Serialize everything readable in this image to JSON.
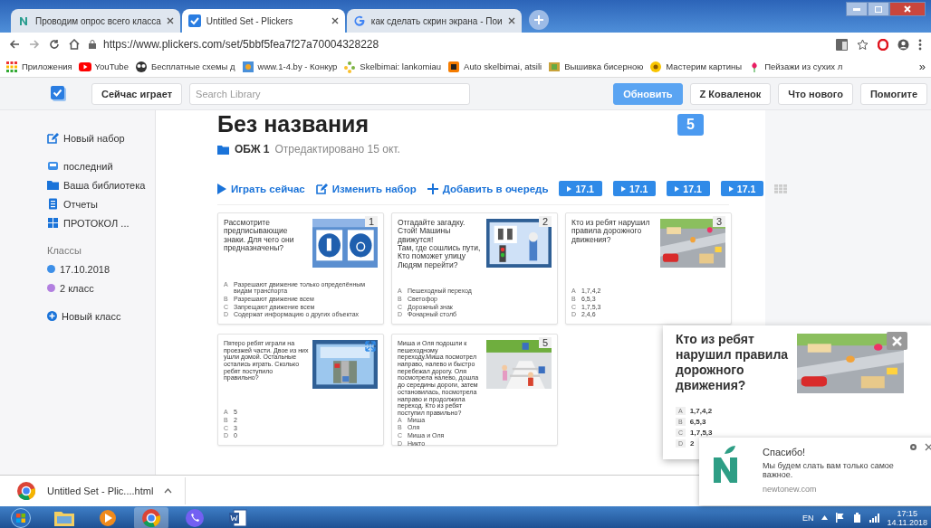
{
  "browser": {
    "tabs": [
      {
        "title": "Проводим опрос всего класса",
        "selected": false
      },
      {
        "title": "Untitled Set - Plickers",
        "selected": true
      },
      {
        "title": "как сделать скрин экрана - Пои",
        "selected": false
      }
    ],
    "url": "https://www.plickers.com/set/5bbf5fea7f27a70004328228",
    "bookmarks": [
      "Приложения",
      "YouTube",
      "Бесплатные схемы д",
      "www.1-4.by - Конкур",
      "Skelbimai: lankomiau",
      "Auto skelbimai, atsili",
      "Вышивка бисерною",
      "Мастерим картины",
      "Пейзажи из сухих л"
    ],
    "more": "»"
  },
  "header": {
    "now_playing": "Сейчас играет",
    "search": {
      "placeholder": "Search Library"
    },
    "buttons": [
      {
        "label": "Обновить",
        "kind": "primary"
      },
      {
        "label": "Z Коваленок",
        "kind": "plain"
      },
      {
        "label": "Что нового",
        "kind": "plain"
      },
      {
        "label": "Помогите",
        "kind": "plain"
      }
    ]
  },
  "sidebar": {
    "new_set": "Новый набор",
    "items": [
      "последний",
      "Ваша библиотека",
      "Отчеты",
      "ПРОТОКОЛ ..."
    ],
    "classes_heading": "Классы",
    "classes": [
      {
        "label": "17.10.2018",
        "color": "#3d8fe8"
      },
      {
        "label": "2 класс",
        "color": "#b27fe0"
      }
    ],
    "new_class": "Новый класс"
  },
  "set": {
    "title": "Без названия",
    "count": "5",
    "folder": "ОБЖ 1",
    "edited": "Отредактировано 15 окт.",
    "actions": [
      "Играть сейчас",
      "Изменить набор",
      "Добавить в очередь"
    ],
    "queue": [
      "17.1",
      "17.1",
      "17.1",
      "17.1"
    ],
    "cards": [
      {
        "number": "1",
        "question": "Рассмотрите предписывающие знаки. Для чего они предназначены?",
        "answers": [
          {
            "letter": "A",
            "text": "Разрешают движение только определённым видам транспорта"
          },
          {
            "letter": "B",
            "text": "Разрешают движение всем"
          },
          {
            "letter": "C",
            "text": "Запрещают движение всем"
          },
          {
            "letter": "D",
            "text": "Содержат информацию о других объектах"
          }
        ]
      },
      {
        "number": "2",
        "question": "Отгадайте загадку.\nСтой! Машины движутся!\nТам, где сошлись пути,\nКто поможет улицу\nЛюдям перейти?",
        "answers": [
          {
            "letter": "A",
            "text": "Пешеходный переход"
          },
          {
            "letter": "B",
            "text": "Светофор"
          },
          {
            "letter": "C",
            "text": "Дорожный знак"
          },
          {
            "letter": "D",
            "text": "Фонарный столб"
          }
        ]
      },
      {
        "number": "3",
        "question": "Кто из ребят нарушил правила дорожного движения?",
        "answers": [
          {
            "letter": "A",
            "text": "1,7,4,2"
          },
          {
            "letter": "B",
            "text": "6,5,3"
          },
          {
            "letter": "C",
            "text": "1,7,5,3"
          },
          {
            "letter": "D",
            "text": "2,4,6"
          }
        ]
      },
      {
        "question": "Пятеро ребят играли на проезжей части. Двое из них ушли домой. Остальные остались играть. Сколько ребят поступило правильно?",
        "answers": [
          {
            "letter": "A",
            "text": "5"
          },
          {
            "letter": "B",
            "text": "2"
          },
          {
            "letter": "C",
            "text": "3"
          },
          {
            "letter": "D",
            "text": "0"
          }
        ]
      },
      {
        "number": "5",
        "question": "Миша и Оля подошли к пешеходному переходу.Миша посмотрел направо, налево и быстро перебежал дорогу. Оля посмотрела налево, дошла до середины дороги, затем остановилась, посмотрела направо и продолжила переход. Кто из ребят поступил правильно?",
        "answers": [
          {
            "letter": "A",
            "text": "Миша"
          },
          {
            "letter": "B",
            "text": "Оля"
          },
          {
            "letter": "C",
            "text": "Миша и Оля"
          },
          {
            "letter": "D",
            "text": "Никто"
          }
        ]
      }
    ]
  },
  "preview": {
    "question": "Кто из ребят нарушил правила дорожного движения?",
    "answers": [
      {
        "letter": "A",
        "text": "1,7,4,2"
      },
      {
        "letter": "B",
        "text": "6,5,3"
      },
      {
        "letter": "C",
        "text": "1,7,5,3"
      },
      {
        "letter": "D",
        "text": "2"
      }
    ]
  },
  "notification": {
    "title": "Спасибо!",
    "message": "Мы будем слать вам только самое важное.",
    "source": "newtonew.com"
  },
  "downloads": [
    {
      "name": "Untitled Set - Plic....html"
    }
  ],
  "taskbar": {
    "apps": [
      {
        "active": false
      },
      {
        "active": false
      },
      {
        "active": false
      },
      {
        "active": true
      },
      {
        "active": false
      },
      {
        "active": false
      }
    ],
    "language": "EN",
    "time": "17:15",
    "date": "14.11.2018"
  }
}
